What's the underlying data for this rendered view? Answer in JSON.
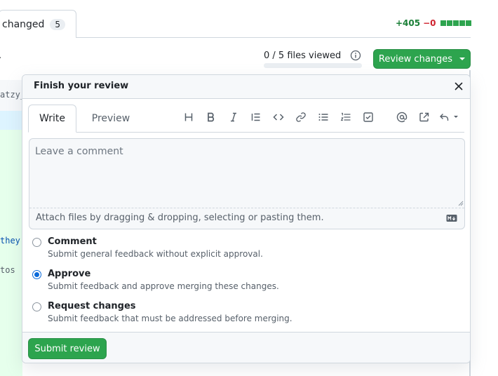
{
  "pr_tabs": {
    "files_changed_label": "changed",
    "files_changed_count": "5"
  },
  "diffstat": {
    "additions": "+405",
    "deletions": "−0",
    "bar_color": "#2da44e"
  },
  "files_viewed": {
    "text": "0 / 5 files viewed",
    "progress_fraction": 0
  },
  "review_button": {
    "label": "Review changes"
  },
  "left_code_snippets": [
    "atzy_",
    "they",
    "tos"
  ],
  "modal": {
    "title": "Finish your review",
    "editor": {
      "tabs": [
        "Write",
        "Preview"
      ],
      "active_tab": "Write",
      "toolbar_icons": [
        "heading-icon",
        "bold-icon",
        "italic-icon",
        "quote-icon",
        "code-icon",
        "link-icon",
        "unordered-list-icon",
        "ordered-list-icon",
        "task-list-icon",
        "mention-icon",
        "reference-icon",
        "saved-replies-icon"
      ],
      "placeholder": "Leave a comment",
      "value": "",
      "attach_hint": "Attach files by dragging & dropping, selecting or pasting them."
    },
    "options": [
      {
        "label": "Comment",
        "description": "Submit general feedback without explicit approval.",
        "checked": false
      },
      {
        "label": "Approve",
        "description": "Submit feedback and approve merging these changes.",
        "checked": true
      },
      {
        "label": "Request changes",
        "description": "Submit feedback that must be addressed before merging.",
        "checked": false
      }
    ],
    "submit_label": "Submit review"
  },
  "colors": {
    "primary_green": "#2da44e",
    "addition_green": "#1a7f37",
    "deletion_red": "#cf222e",
    "radio_blue": "#0969da"
  }
}
